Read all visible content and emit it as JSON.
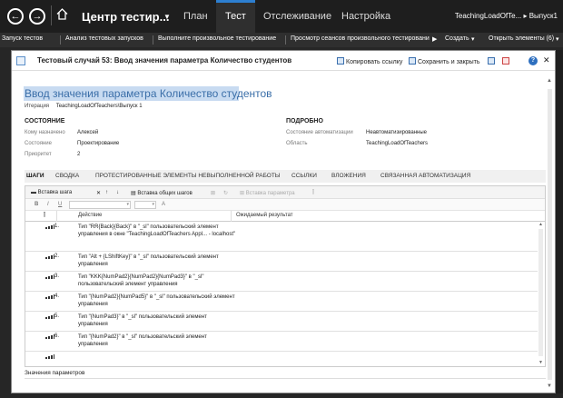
{
  "topbar": {
    "project_name": "Центр тестир...",
    "tabs": [
      {
        "label": "План"
      },
      {
        "label": "Тест"
      },
      {
        "label": "Отслеживание"
      },
      {
        "label": "Настройка"
      }
    ],
    "breadcrumb": "TeachingLoadOfTe... ▸ Выпуск1"
  },
  "subbar": {
    "items": [
      "Запуск тестов",
      "Анализ тестовых запусков",
      "Выполните произвольное тестирование",
      "Просмотр сеансов произвольного тестировани",
      "Создать",
      "Открыть элементы (6)"
    ]
  },
  "dialog": {
    "title": "Тестовый случай 53: Ввод значения параметра Количество студентов",
    "copy_link": "Копировать ссылку",
    "save_close": "Сохранить и закрыть",
    "help": "?",
    "testcase_title": "Ввод значения параметра Количество студентов",
    "iteration_label": "Итерация",
    "iteration_value": "TeachingLoadOfTeachers\\Выпуск 1",
    "status": {
      "header": "СОСТОЯНИЕ",
      "assigned_label": "Кому назначено",
      "assigned_value": "Алексей",
      "state_label": "Состояние",
      "state_value": "Проектирование",
      "priority_label": "Приоритет",
      "priority_value": "2"
    },
    "details": {
      "header": "ПОДРОБНО",
      "automation_label": "Состояние автоматизации",
      "automation_value": "Неавтоматизированные",
      "area_label": "Область",
      "area_value": "TeachingLoadOfTeachers"
    },
    "tabs": [
      "ШАГИ",
      "СВОДКА",
      "ПРОТЕСТИРОВАННЫЕ ЭЛЕМЕНТЫ НЕВЫПОЛНЕННОЙ РАБОТЫ",
      "ССЫЛКИ",
      "ВЛОЖЕНИЯ",
      "СВЯЗАННАЯ АВТОМАТИЗАЦИЯ"
    ],
    "steps_toolbar": {
      "insert_step": "Вставка шага",
      "insert_shared": "Вставка общих шагов",
      "insert_param": "Вставка параметра"
    },
    "columns": {
      "action": "Действие",
      "expected": "Ожидаемый результат"
    },
    "steps": [
      {
        "num": "1.",
        "action": "Тип \"RR{Back}{Back}\" в \"_sl\" пользовательский элемент управления в окне \"TeachingLoadOfTeachers Appl... - localhost\""
      },
      {
        "num": "2.",
        "action": "Тип \"Alt + {LShiftKey}\" в \"_sl\" пользовательский элемент управления"
      },
      {
        "num": "3.",
        "action": "Тип \"KKK{NumPad2}{NumPad2}{NumPad3}\" в \"_sl\" пользовательский элемент управления"
      },
      {
        "num": "4.",
        "action": "Тип \"{NumPad2}{NumPad5}\" в \"_sl\" пользовательский элемент управления"
      },
      {
        "num": "5.",
        "action": "Тип \"{NumPad3}\" в \"_sl\" пользовательский элемент управления"
      },
      {
        "num": "6.",
        "action": "Тип \"{NumPad2}\" в \"_sl\" пользовательский элемент управления"
      }
    ],
    "params_label": "Значения параметров"
  }
}
